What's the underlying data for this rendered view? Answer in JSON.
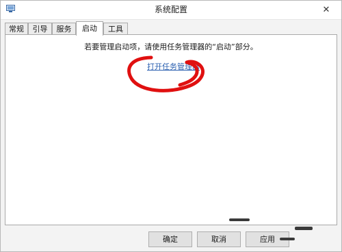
{
  "window": {
    "title": "系统配置",
    "close_glyph": "✕"
  },
  "tabs": [
    {
      "label": "常规",
      "active": false
    },
    {
      "label": "引导",
      "active": false
    },
    {
      "label": "服务",
      "active": false
    },
    {
      "label": "启动",
      "active": true
    },
    {
      "label": "工具",
      "active": false
    }
  ],
  "startup": {
    "info_text": "若要管理启动项，请使用任务管理器的“启动”部分。",
    "link_text": "打开任务管理器"
  },
  "annotation": {
    "color": "#e01010"
  },
  "buttons": {
    "ok": "确定",
    "cancel": "取消",
    "apply": "应用"
  }
}
